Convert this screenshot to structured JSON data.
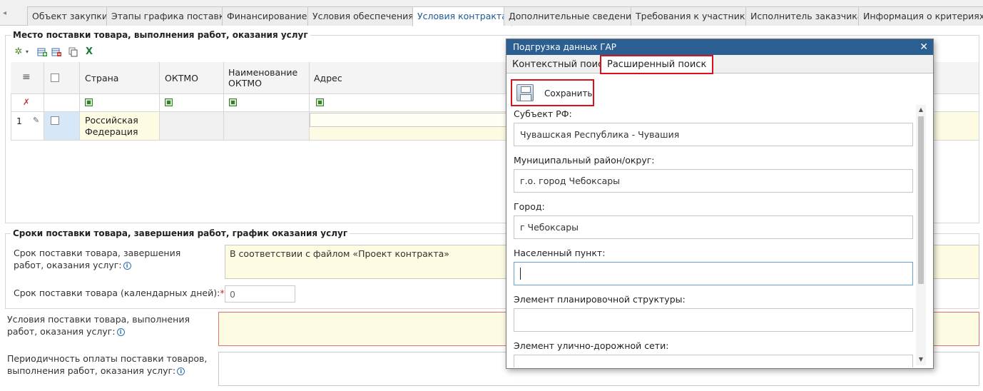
{
  "tabs": {
    "items": [
      "Объект закупки",
      "Этапы графика поставки",
      "Финансирование",
      "Условия обеспечения",
      "Условия контракта",
      "Дополнительные сведения",
      "Требования к участнику",
      "Исполнитель заказчика",
      "Информация о критериях"
    ],
    "active_index": 4
  },
  "delivery_place": {
    "legend": "Место поставки товара, выполнения работ, оказания услуг",
    "columns": [
      "Страна",
      "ОКТМО",
      "Наименование ОКТМО",
      "Адрес"
    ],
    "rows": [
      {
        "num": "1",
        "country": "Российская Федерация",
        "oktmo": "",
        "oktmo_name": "",
        "address": ""
      }
    ]
  },
  "delivery_terms": {
    "legend": "Сроки поставки товара, завершения работ, график оказания услуг",
    "term_label": "Срок поставки товара, завершения работ, оказания услуг:",
    "term_value": "В соответствии с файлом «Проект контракта»",
    "days_label": "Срок поставки товара (календарных дней):",
    "days_value": "0"
  },
  "conditions_label": "Условия поставки товара, выполнения работ, оказания услуг:",
  "periodicity_label": "Периодичность оплаты поставки товаров, выполнения работ, оказания услуг:",
  "dialog": {
    "title": "Подгрузка данных ГАР",
    "tabs": [
      "Контекстный поиск",
      "Расширенный поиск"
    ],
    "active_tab": 1,
    "save_label": "Сохранить",
    "fields": [
      {
        "label": "Субъект РФ:",
        "value": "Чувашская Республика - Чувашия"
      },
      {
        "label": "Муниципальный район/округ:",
        "value": "г.о. город Чебоксары"
      },
      {
        "label": "Город:",
        "value": "г Чебоксары"
      },
      {
        "label": "Населенный пункт:",
        "value": ""
      },
      {
        "label": "Элемент планировочной структуры:",
        "value": ""
      },
      {
        "label": "Элемент улично-дорожной сети:",
        "value": ""
      }
    ]
  },
  "colors": {
    "accent": "#2b5f92",
    "highlight": "#d8121d",
    "required_bg": "#fdfbe1"
  }
}
